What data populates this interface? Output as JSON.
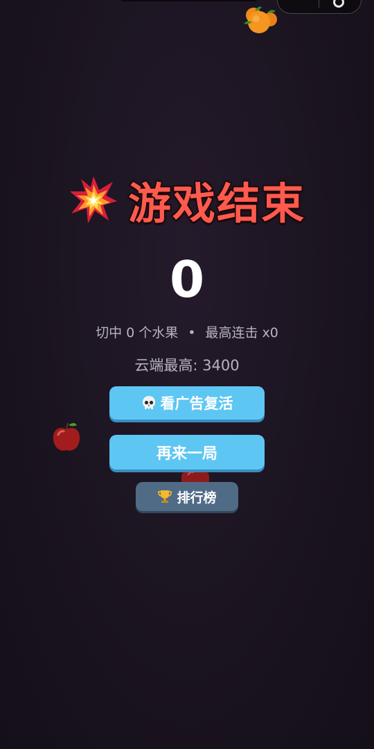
{
  "title": "游戏结束",
  "score": "0",
  "stats": {
    "fruits_cut": "切中 0 个水果",
    "separator": "•",
    "best_combo": "最高连击 x0"
  },
  "cloud_best": "云端最高: 3400",
  "buttons": {
    "revive_label": "看广告复活",
    "play_again_label": "再来一局",
    "leaderboard_label": "排行榜"
  },
  "icons": {
    "title": "explosion-icon",
    "revive": "skull-icon",
    "leaderboard": "trophy-icon"
  },
  "colors": {
    "title": "#ff5a4e",
    "primary_button": "#5ec6f3",
    "secondary_button": "#506b86",
    "background": "#1b1420"
  }
}
